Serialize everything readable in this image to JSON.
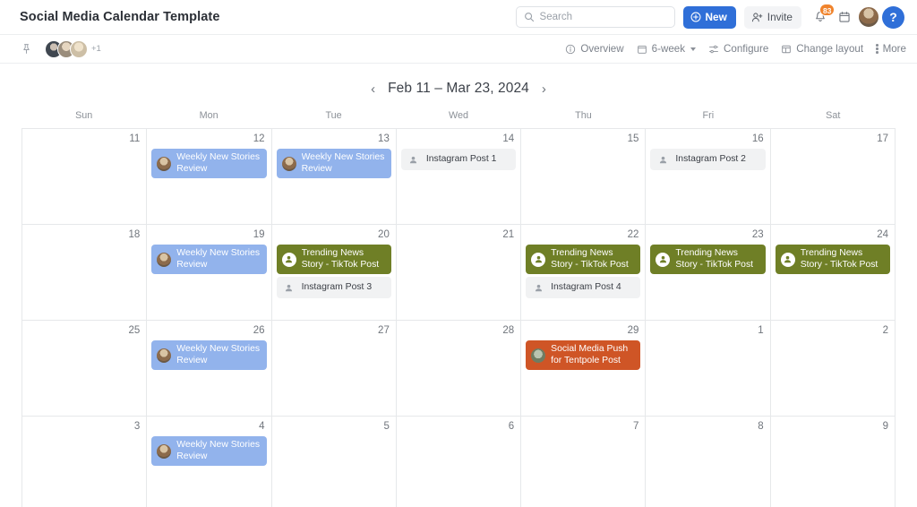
{
  "header": {
    "title": "Social Media Calendar Template",
    "search": {
      "placeholder": "Search",
      "icon": "search-icon"
    },
    "new_button": {
      "label": "New",
      "icon": "plus-circle-icon",
      "color": "#2f6fd8"
    },
    "invite_button": {
      "label": "Invite",
      "icon": "user-plus-icon"
    },
    "notifications": {
      "icon": "bell-icon",
      "badge": "83",
      "badge_color": "#f0832c"
    },
    "calendar_icon": "calendar-icon",
    "avatar": "user-avatar",
    "help_button": {
      "label": "?",
      "icon": "help-icon",
      "color": "#2f6fd8"
    }
  },
  "subbar": {
    "pin_icon": "pin-icon",
    "avatars_overflow": "+1",
    "items": [
      {
        "label": "Overview",
        "icon": "info-circle-icon"
      },
      {
        "label": "6-week",
        "icon": "calendar-icon",
        "has_caret": true
      },
      {
        "label": "Configure",
        "icon": "sliders-icon"
      },
      {
        "label": "Change layout",
        "icon": "layout-icon"
      },
      {
        "label": "More",
        "icon": "kebab-icon"
      }
    ]
  },
  "datenav": {
    "prev": "‹",
    "next": "›",
    "range": "Feb 11 – Mar 23, 2024"
  },
  "calendar": {
    "weekdays": [
      "Sun",
      "Mon",
      "Tue",
      "Wed",
      "Thu",
      "Fri",
      "Sat"
    ],
    "weeks": [
      [
        {
          "day": "11",
          "events": []
        },
        {
          "day": "12",
          "events": [
            {
              "title": "Weekly New Stories Review",
              "style": "ev-blue",
              "icon": "avatar-icon"
            }
          ]
        },
        {
          "day": "13",
          "events": [
            {
              "title": "Weekly New Stories Review",
              "style": "ev-blue",
              "icon": "avatar-icon"
            }
          ]
        },
        {
          "day": "14",
          "events": [
            {
              "title": "Instagram Post 1",
              "style": "ev-grey",
              "icon": "person-icon"
            }
          ]
        },
        {
          "day": "15",
          "events": []
        },
        {
          "day": "16",
          "events": [
            {
              "title": "Instagram Post 2",
              "style": "ev-grey",
              "icon": "person-icon"
            }
          ]
        },
        {
          "day": "17",
          "events": []
        }
      ],
      [
        {
          "day": "18",
          "events": []
        },
        {
          "day": "19",
          "events": [
            {
              "title": "Weekly New Stories Review",
              "style": "ev-blue",
              "icon": "avatar-icon"
            }
          ]
        },
        {
          "day": "20",
          "events": [
            {
              "title": "Trending News Story - TikTok Post",
              "style": "ev-green",
              "icon": "person-icon"
            },
            {
              "title": "Instagram Post 3",
              "style": "ev-grey",
              "icon": "person-icon"
            }
          ]
        },
        {
          "day": "21",
          "events": []
        },
        {
          "day": "22",
          "events": [
            {
              "title": "Trending News Story - TikTok Post",
              "style": "ev-green",
              "icon": "person-icon"
            },
            {
              "title": "Instagram Post 4",
              "style": "ev-grey",
              "icon": "person-icon"
            }
          ]
        },
        {
          "day": "23",
          "events": [
            {
              "title": "Trending News Story - TikTok Post",
              "style": "ev-green",
              "icon": "person-icon"
            }
          ]
        },
        {
          "day": "24",
          "events": [
            {
              "title": "Trending News Story - TikTok Post",
              "style": "ev-green",
              "icon": "person-icon"
            }
          ]
        }
      ],
      [
        {
          "day": "25",
          "events": []
        },
        {
          "day": "26",
          "events": [
            {
              "title": "Weekly New Stories Review",
              "style": "ev-blue",
              "icon": "avatar-icon"
            }
          ]
        },
        {
          "day": "27",
          "events": []
        },
        {
          "day": "28",
          "events": []
        },
        {
          "day": "29",
          "events": [
            {
              "title": "Social Media Push for Tentpole Post",
              "style": "ev-orange",
              "icon": "avatar-icon"
            }
          ]
        },
        {
          "day": "1",
          "events": []
        },
        {
          "day": "2",
          "events": []
        }
      ],
      [
        {
          "day": "3",
          "events": []
        },
        {
          "day": "4",
          "events": [
            {
              "title": "Weekly New Stories Review",
              "style": "ev-blue",
              "icon": "avatar-icon"
            }
          ]
        },
        {
          "day": "5",
          "events": []
        },
        {
          "day": "6",
          "events": []
        },
        {
          "day": "7",
          "events": []
        },
        {
          "day": "8",
          "events": []
        },
        {
          "day": "9",
          "events": []
        }
      ]
    ]
  },
  "colors": {
    "accent": "#2f6fd8",
    "event_blue": "#92b3ec",
    "event_green": "#6f7f26",
    "event_orange": "#cf5526",
    "event_grey": "#f1f2f3",
    "badge_orange": "#f0832c"
  }
}
